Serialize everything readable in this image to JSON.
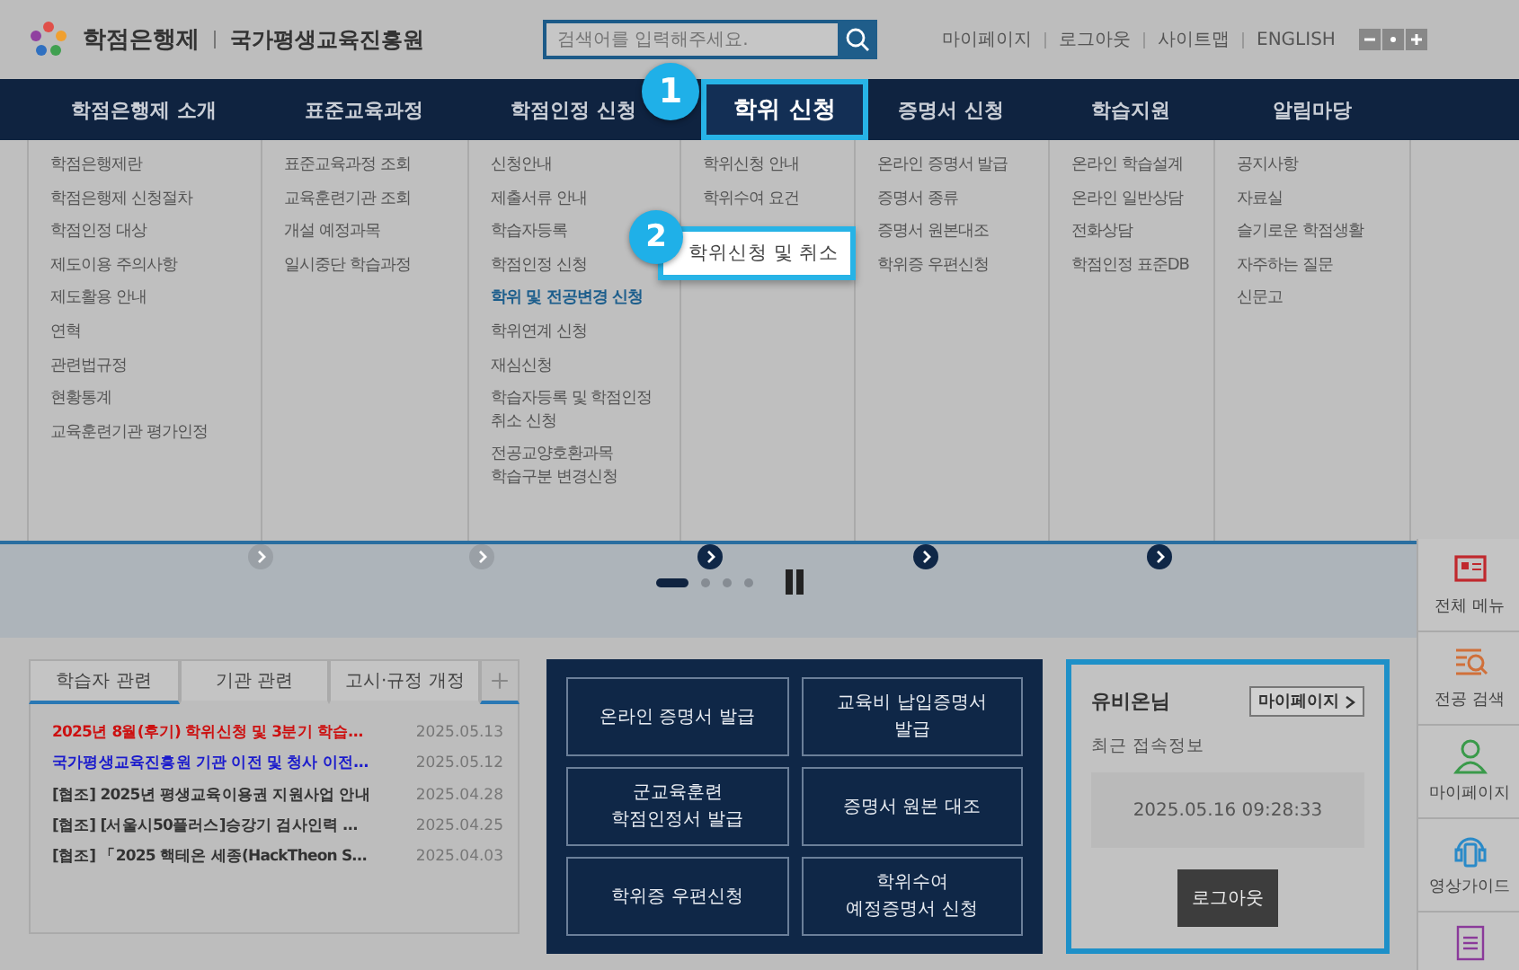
{
  "header": {
    "logo": "학점은행제",
    "org": "국가평생교육진흥원",
    "search": {
      "placeholder": "검색어를 입력해주세요."
    },
    "links": [
      "마이페이지",
      "로그아웃",
      "사이트맵",
      "ENGLISH"
    ]
  },
  "nav": [
    {
      "label": "학점은행제 소개",
      "selected": false,
      "menu": [
        {
          "label": "학점은행제란",
          "highlighted": false
        },
        {
          "label": "학점은행제 신청절차",
          "highlighted": false
        },
        {
          "label": "학점인정 대상",
          "highlighted": false
        },
        {
          "label": "제도이용 주의사항",
          "highlighted": false
        },
        {
          "label": "제도활용 안내",
          "highlighted": false
        },
        {
          "label": "연혁",
          "highlighted": false
        },
        {
          "label": "관련법규정",
          "highlighted": false
        },
        {
          "label": "현황통계",
          "highlighted": false
        },
        {
          "label": "교육훈련기관 평가인정",
          "highlighted": false
        }
      ]
    },
    {
      "label": "표준교육과정",
      "selected": false,
      "menu": [
        {
          "label": "표준교육과정 조회",
          "highlighted": false
        },
        {
          "label": "교육훈련기관 조회",
          "highlighted": false
        },
        {
          "label": "개설 예정과목",
          "highlighted": false
        },
        {
          "label": "일시중단 학습과정",
          "highlighted": false
        }
      ]
    },
    {
      "label": "학점인정 신청",
      "selected": false,
      "menu": [
        {
          "label": "신청안내",
          "highlighted": false
        },
        {
          "label": "제출서류 안내",
          "highlighted": false
        },
        {
          "label": "학습자등록",
          "highlighted": false
        },
        {
          "label": "학점인정 신청",
          "highlighted": false
        },
        {
          "label": "학위 및 전공변경 신청",
          "highlighted": true
        },
        {
          "label": "학위연계 신청",
          "highlighted": false
        },
        {
          "label": "재심신청",
          "highlighted": false
        },
        {
          "label": "학습자등록 및 학점인정\n취소 신청",
          "highlighted": false
        },
        {
          "label": "전공교양호환과목\n학습구분 변경신청",
          "highlighted": false
        }
      ]
    },
    {
      "label": "학위 신청",
      "selected": true,
      "menu": [
        {
          "label": "학위신청 안내",
          "highlighted": false
        },
        {
          "label": "학위수여 요건",
          "highlighted": false
        }
      ]
    },
    {
      "label": "증명서 신청",
      "selected": false,
      "menu": [
        {
          "label": "온라인 증명서 발급",
          "highlighted": false
        },
        {
          "label": "증명서 종류",
          "highlighted": false
        },
        {
          "label": "증명서 원본대조",
          "highlighted": false
        },
        {
          "label": "학위증 우편신청",
          "highlighted": false
        }
      ]
    },
    {
      "label": "학습지원",
      "selected": false,
      "menu": [
        {
          "label": "온라인 학습설계",
          "highlighted": false
        },
        {
          "label": "온라인 일반상담",
          "highlighted": false
        },
        {
          "label": "전화상담",
          "highlighted": false
        },
        {
          "label": "학점인정 표준DB",
          "highlighted": false
        }
      ]
    },
    {
      "label": "알림마당",
      "selected": false,
      "menu": [
        {
          "label": "공지사항",
          "highlighted": false
        },
        {
          "label": "자료실",
          "highlighted": false
        },
        {
          "label": "슬기로운 학점생활",
          "highlighted": false
        },
        {
          "label": "자주하는 질문",
          "highlighted": false
        },
        {
          "label": "신문고",
          "highlighted": false
        }
      ]
    }
  ],
  "callouts": [
    {
      "number": "1"
    },
    {
      "number": "2",
      "label": "학위신청 및 취소"
    }
  ],
  "slider": {
    "pages": [
      {
        "selected": true
      },
      {
        "selected": false
      },
      {
        "selected": false
      },
      {
        "selected": false
      }
    ]
  },
  "notices": {
    "tabs": [
      {
        "label": "학습자 관련",
        "selected": true
      },
      {
        "label": "기관 관련",
        "selected": false
      },
      {
        "label": "고시·규정 개정",
        "selected": false
      }
    ],
    "items": [
      {
        "title": "2025년 8월(후기) 학위신청 및 3분기 학습…",
        "date": "2025.05.13",
        "color": "#cc1111"
      },
      {
        "title": "국가평생교육진흥원 기관 이전 및 청사 이전…",
        "date": "2025.05.12",
        "color": "#1a1acc"
      },
      {
        "title": "[협조] 2025년 평생교육이용권 지원사업 안내",
        "date": "2025.04.28",
        "color": "#333333"
      },
      {
        "title": "[협조] [서울시50플러스]승강기 검사인력 …",
        "date": "2025.04.25",
        "color": "#333333"
      },
      {
        "title": "[협조] 「2025 핵테온 세종(HackTheon S…",
        "date": "2025.04.03",
        "color": "#333333"
      }
    ]
  },
  "services": [
    "온라인 증명서 발급",
    "교육비 납입증명서\n발급",
    "군교육훈련\n학점인정서 발급",
    "증명서 원본 대조",
    "학위증 우편신청",
    "학위수여\n예정증명서 신청"
  ],
  "user": {
    "name": "유비온님",
    "mypage": "마이페이지",
    "recent_label": "최근 접속정보",
    "last_login": "2025.05.16 09:28:33",
    "logout": "로그아웃"
  },
  "quick_menu": [
    {
      "kind": "menu",
      "label": "전체 메뉴"
    },
    {
      "kind": "search",
      "label": "전공 검색"
    },
    {
      "kind": "person",
      "label": "마이페이지"
    },
    {
      "kind": "headset",
      "label": "영상가이드"
    },
    {
      "kind": "form"
    }
  ]
}
